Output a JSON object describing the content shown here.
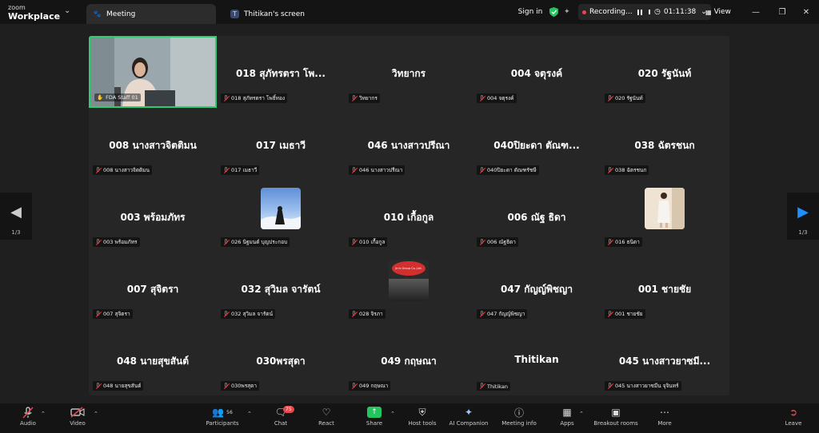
{
  "app": {
    "brand_top": "zoom",
    "brand_bottom": "Workplace"
  },
  "tabs": [
    {
      "label": "Meeting"
    },
    {
      "label": "Thitikan's screen",
      "avatar": "T"
    }
  ],
  "titlebar": {
    "signin": "Sign in",
    "recording": "Recording...",
    "timer": "01:11:38",
    "view": "View"
  },
  "colors": {
    "active_border": "#2ecc71",
    "muted": "#e5484d",
    "share": "#22c55e",
    "nav_arrow": "#1e90ff"
  },
  "participants": [
    {
      "tile": "",
      "label": "FDA Staff 01"
    },
    {
      "tile": "018 สุภัทรตรา โพ...",
      "label": "018 สุภัทรตรา โพธิ์ทอง"
    },
    {
      "tile": "วิทยากร",
      "label": "วิทยากร"
    },
    {
      "tile": "004 จตุรงค์",
      "label": "004 จตุรงค์"
    },
    {
      "tile": "020 รัฐนันท์",
      "label": "020 รัฐนันท์"
    },
    {
      "tile": "008 นางสาวจิตติมน",
      "label": "008 นางสาวจิตติมน"
    },
    {
      "tile": "017 เมธาวี",
      "label": "017 เมธาวี"
    },
    {
      "tile": "046 นางสาวปรีณา",
      "label": "046 นางสาวปรีณา"
    },
    {
      "tile": "040ปิยะดา  ตัณฑ...",
      "label": "040ปิยะดา  ตัณฑรัชษี"
    },
    {
      "tile": "038 ฉัตรชนก",
      "label": "038 ฉัตรชนก"
    },
    {
      "tile": "003 พร้อมภัทร",
      "label": "003 พร้อมภัทร"
    },
    {
      "tile": "",
      "label": "026 นิฐมนต์ บุญประกอบ"
    },
    {
      "tile": "010 เกื้อกูล",
      "label": "010 เกื้อกูล"
    },
    {
      "tile": "006 ณัฐ ธิดา",
      "label": "006 ณัฐธิดา"
    },
    {
      "tile": "",
      "label": "016 ธนิดา"
    },
    {
      "tile": "007 สุจิตรา",
      "label": "007 สุจิตรา"
    },
    {
      "tile": "032 สุวิมล จารัตน์",
      "label": "032 สุวิมล จารัตน์"
    },
    {
      "tile": "",
      "label": "028 จิรภา"
    },
    {
      "tile": "047 กัญญ์พิชญา",
      "label": "047 กัญญ์พิชญา"
    },
    {
      "tile": "001 ชายชัย",
      "label": "001 ชายชัย"
    },
    {
      "tile": "048 นายสุขสันต์",
      "label": "048 นายสุขสันต์"
    },
    {
      "tile": "030พรสุดา",
      "label": "030พรสุดา"
    },
    {
      "tile": "049 กฤษณา",
      "label": "049 กฤษณา"
    },
    {
      "tile": "Thitikan",
      "label": "Thitikan"
    },
    {
      "tile": "045 นางสาวยาซมี...",
      "label": "045 นางสาวยาซมีน จุจินทร์"
    }
  ],
  "photo_tile_text": "Jin's Group Co.,Ltd.",
  "pagination": {
    "left": "1/3",
    "right": "1/3"
  },
  "toolbar": {
    "audio": "Audio",
    "video": "Video",
    "participants": "Participants",
    "participants_count": "56",
    "chat": "Chat",
    "chat_badge": "75",
    "react": "React",
    "share": "Share",
    "host_tools": "Host tools",
    "ai_companion": "AI Companion",
    "meeting_info": "Meeting info",
    "apps": "Apps",
    "breakout_rooms": "Breakout rooms",
    "more": "More",
    "leave": "Leave"
  }
}
